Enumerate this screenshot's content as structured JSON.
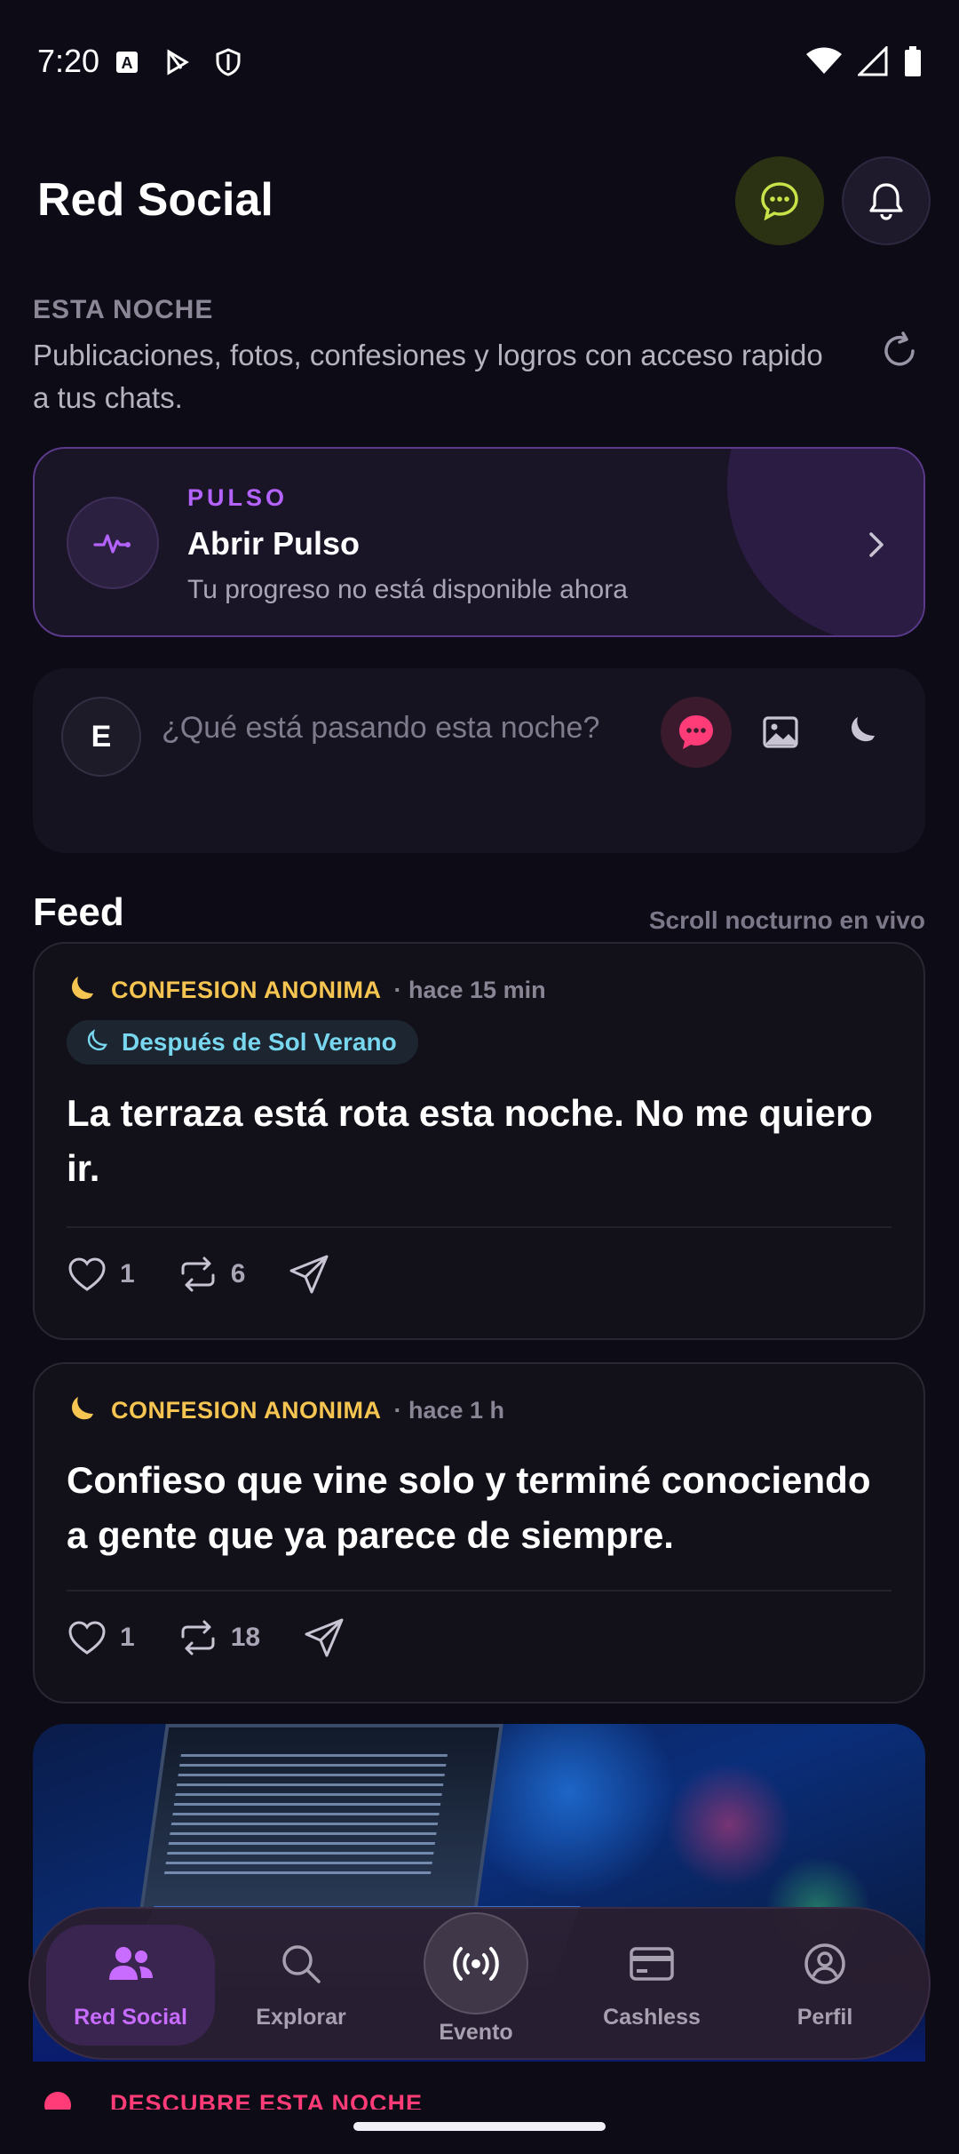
{
  "status_bar": {
    "time": "7:20"
  },
  "header": {
    "title": "Red Social",
    "chat_icon": "chat-bubble-icon",
    "bell_icon": "bell-icon"
  },
  "intro": {
    "kicker": "ESTA NOCHE",
    "text": "Publicaciones, fotos, confesiones y logros con acceso rapido a tus chats."
  },
  "pulse": {
    "label": "PULSO",
    "title": "Abrir Pulso",
    "subtitle": "Tu progreso no está disponible ahora"
  },
  "composer": {
    "avatar_letter": "E",
    "placeholder": "¿Qué está pasando esta noche?"
  },
  "feed": {
    "title": "Feed",
    "note": "Scroll nocturno en vivo",
    "posts": [
      {
        "type": "CONFESION ANONIMA",
        "time": "· hace 15 min",
        "tag": "Después de Sol Verano",
        "body": "La terraza está rota esta noche. No me quiero ir.",
        "likes": "1",
        "reposts": "6"
      },
      {
        "type": "CONFESION ANONIMA",
        "time": "· hace 1 h",
        "body": "Confieso que vine solo y terminé conociendo a gente que ya parece de siempre.",
        "likes": "1",
        "reposts": "18"
      }
    ],
    "peek_text": "DESCUBRE ESTA NOCHE"
  },
  "bottom_nav": {
    "items": [
      {
        "label": "Red Social",
        "icon": "people-icon",
        "active": true
      },
      {
        "label": "Explorar",
        "icon": "search-icon",
        "active": false
      },
      {
        "label": "Evento",
        "icon": "broadcast-icon",
        "active": false
      },
      {
        "label": "Cashless",
        "icon": "card-icon",
        "active": false
      },
      {
        "label": "Perfil",
        "icon": "profile-icon",
        "active": false
      }
    ]
  },
  "colors": {
    "background": "#0d0b15",
    "accent": "#c86bff",
    "confession": "#f5c451",
    "tag": "#78d7ee",
    "pink": "#ff3c78"
  }
}
